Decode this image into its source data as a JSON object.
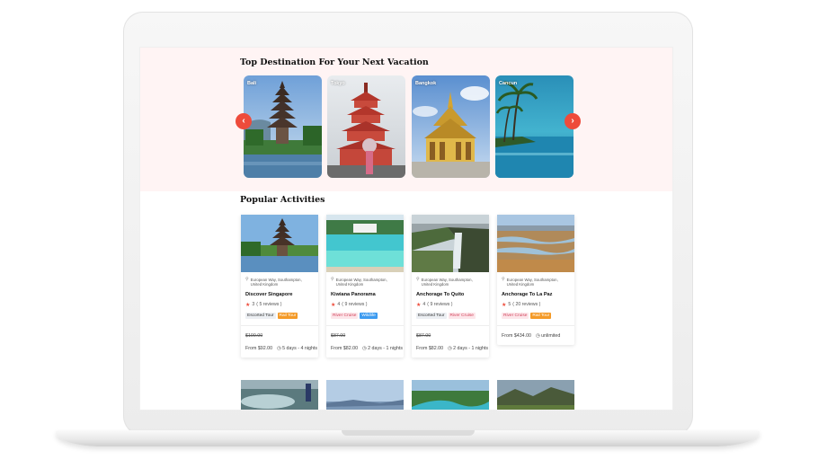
{
  "destinations": {
    "title": "Top Destination For Your Next Vacation",
    "prev_icon": "chevron-left-icon",
    "next_icon": "chevron-right-icon",
    "items": [
      {
        "name": "Bali"
      },
      {
        "name": "Tokyo"
      },
      {
        "name": "Bangkok"
      },
      {
        "name": "Cancun"
      }
    ]
  },
  "activities": {
    "title": "Popular Activities",
    "items": [
      {
        "location": "European Way, Southampton, United Kingdom",
        "title": "Discover Singapore",
        "rating_value": "3",
        "reviews": "( 5 reviews )",
        "tags": [
          "Escorted Tour",
          "Rail Tour"
        ],
        "old_price": "$100.00",
        "price": "From $92.00",
        "duration": "5 days - 4 nights"
      },
      {
        "location": "European Way, Southampton, United Kingdom",
        "title": "Kiwiana Panorama",
        "rating_value": "4",
        "reviews": "( 9 reviews )",
        "tags": [
          "River Cruise",
          "Wildlife"
        ],
        "old_price": "$87.00",
        "price": "From $82.00",
        "duration": "2 days - 1 nights"
      },
      {
        "location": "European Way, Southampton, United Kingdom",
        "title": "Anchorage To Quito",
        "rating_value": "4",
        "reviews": "( 9 reviews )",
        "tags": [
          "Escorted Tour",
          "River Cruise"
        ],
        "old_price": "$87.00",
        "price": "From $82.00",
        "duration": "2 days - 1 nights"
      },
      {
        "location": "European Way, Southampton, United Kingdom",
        "title": "Anchorage To La Paz",
        "rating_value": "5",
        "reviews": "( 20 reviews )",
        "tags": [
          "River Cruise",
          "Rail Tour"
        ],
        "old_price": "",
        "price": "From $434.00",
        "duration": "unlimited"
      }
    ]
  },
  "colors": {
    "accent": "#ee4b3b",
    "hero_bg": "#fff4f4",
    "rail_tag": "#f49a27",
    "wildlife_tag": "#3d9bf0",
    "river_tag_text": "#d0425a"
  }
}
